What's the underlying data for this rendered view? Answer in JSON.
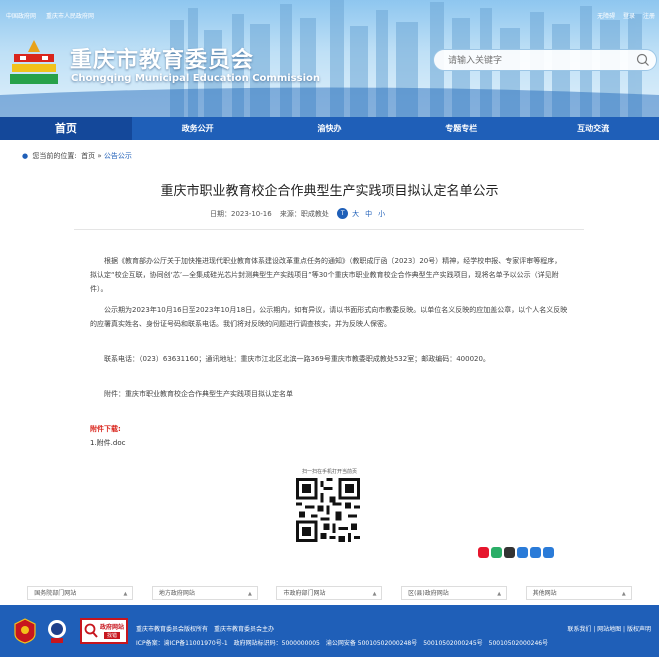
{
  "top_links": {
    "left": [
      "中国政府网",
      "重庆市人民政府网"
    ],
    "right": [
      "无障碍",
      "登录",
      "注册"
    ]
  },
  "site": {
    "title": "重庆市教育委员会",
    "subtitle": "Chongqing Municipal Education Commission"
  },
  "search": {
    "placeholder": "请输入关键字",
    "icon": "search-icon"
  },
  "nav": {
    "items": [
      {
        "label": "首页"
      },
      {
        "label": "政务公开"
      },
      {
        "label": "渝快办"
      },
      {
        "label": "专题专栏"
      },
      {
        "label": "互动交流"
      }
    ]
  },
  "breadcrumb": {
    "prefix": "您当前的位置:",
    "home": "首页",
    "separator": "»",
    "current": "公告公示"
  },
  "article": {
    "title": "重庆市职业教育校企合作典型生产实践项目拟认定名单公示",
    "date": "日期：2023-10-16",
    "source": "来源：职成教处",
    "font_size_large": "大",
    "font_size_medium": "中",
    "font_size_small": "小",
    "paragraphs": [
      "根据《教育部办公厅关于加快推进现代职业教育体系建设改革重点任务的通知》（教职成厅函〔2023〕20号）精神，经学校申报、专家评审等程序，拟认定“校企互联，协同创‘芯’—全集成硅光芯片封测典型生产实践项目”等30个重庆市职业教育校企合作典型生产实践项目，现将名单予以公示（详见附件）。",
      "公示期为2023年10月16日至2023年10月18日，公示期内，如有异议，请以书面形式向市教委反映。以单位名义反映的应加盖公章，以个人名义反映的应署真实姓名、身份证号码和联系电话。我们将对反映的问题进行调查核实，并为反映人保密。",
      "联系电话：（023）63631160；通讯地址：重庆市江北区北滨一路369号重庆市教委职成教处532室；邮政编码：400020。",
      "附件：重庆市职业教育校企合作典型生产实践项目拟认定名单"
    ]
  },
  "attachments": {
    "heading": "附件下载:",
    "files": [
      "1.附件.doc"
    ]
  },
  "qr": {
    "caption": "扫一扫在手机打开当前页"
  },
  "share_icons": [
    "weibo-icon",
    "wechat-icon",
    "qq-icon",
    "email-icon",
    "print-icon",
    "copy-icon"
  ],
  "link_selects": [
    "国务院部门网站",
    "地方政府网站",
    "市政府部门网站",
    "区(县)政府网站",
    "其他网站"
  ],
  "footer": {
    "gov_badge_text": "政府网站",
    "gov_badge_sub": "找错",
    "line1": "重庆市教育委员会版权所有　重庆市教育委员会主办",
    "line2": "ICP备案：渝ICP备11001970号-1　政府网站标识码：5000000005　渝公网安备 50010502000248号　50010502000245号　50010502000246号",
    "right_links": "联系我们 | 网站地图 | 版权声明"
  },
  "colors": {
    "nav_blue": "#1f5fb8",
    "nav_home": "#14489a",
    "accent_red": "#d9251c"
  }
}
